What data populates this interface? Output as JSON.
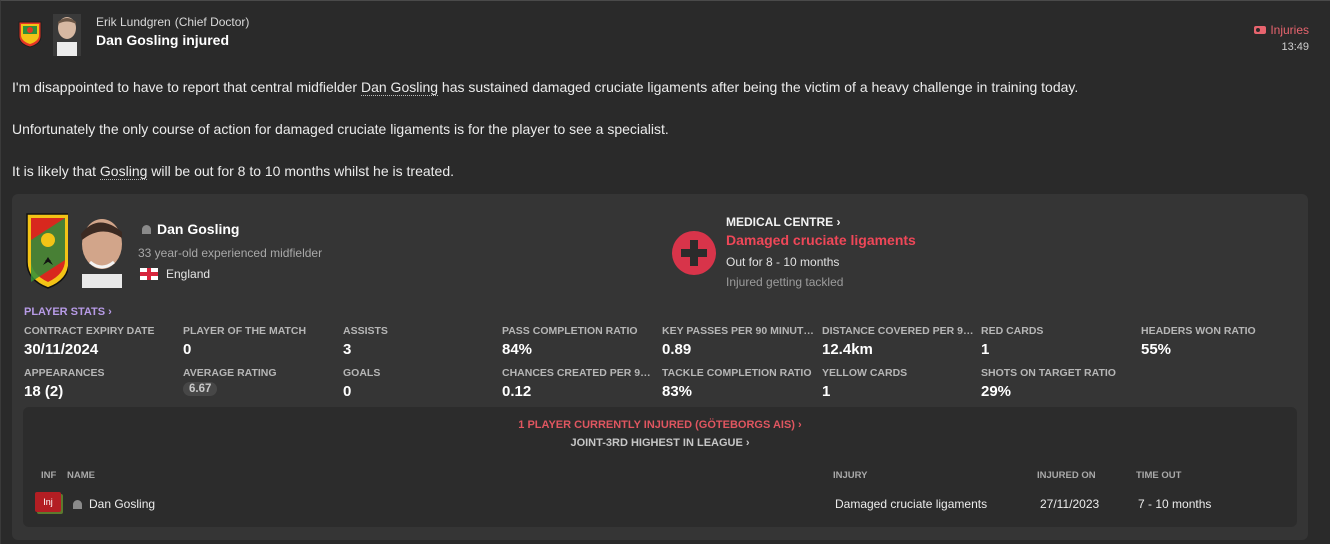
{
  "header": {
    "sender_name": "Erik Lundgren",
    "sender_role": "(Chief Doctor)",
    "subject": "Dan Gosling injured",
    "tag": "Injuries",
    "time": "13:49"
  },
  "message": {
    "p1_pre": "I'm disappointed to have to report that central midfielder ",
    "p1_link": "Dan Gosling",
    "p1_post": " has sustained damaged cruciate ligaments after being the victim of a heavy challenge in training today.",
    "p2": "Unfortunately the only course of action for damaged cruciate ligaments is for the player to see a specialist.",
    "p3_pre": "It is likely that ",
    "p3_link": "Gosling",
    "p3_post": " will be out for 8 to 10 months whilst he is treated."
  },
  "player": {
    "name": "Dan Gosling",
    "description": "33 year-old experienced midfielder",
    "nation": "England"
  },
  "medical": {
    "title": "MEDICAL CENTRE",
    "injury": "Damaged cruciate ligaments",
    "out_for": "Out for 8 - 10 months",
    "cause": "Injured getting tackled"
  },
  "stats": {
    "title": "PLAYER STATS",
    "items": [
      {
        "label": "CONTRACT EXPIRY DATE",
        "value": "30/11/2024"
      },
      {
        "label": "PLAYER OF THE MATCH",
        "value": "0"
      },
      {
        "label": "ASSISTS",
        "value": "3"
      },
      {
        "label": "PASS COMPLETION RATIO",
        "value": "84%"
      },
      {
        "label": "KEY PASSES PER 90 MINUTES",
        "value": "0.89"
      },
      {
        "label": "DISTANCE COVERED PER 90...",
        "value": "12.4km"
      },
      {
        "label": "RED CARDS",
        "value": "1"
      },
      {
        "label": "HEADERS WON RATIO",
        "value": "55%"
      },
      {
        "label": "APPEARANCES",
        "value": "18 (2)"
      },
      {
        "label": "AVERAGE RATING",
        "value": "6.67"
      },
      {
        "label": "GOALS",
        "value": "0"
      },
      {
        "label": "CHANCES CREATED PER 90...",
        "value": "0.12"
      },
      {
        "label": "TACKLE COMPLETION RATIO",
        "value": "83%"
      },
      {
        "label": "YELLOW CARDS",
        "value": "1"
      },
      {
        "label": "SHOTS ON TARGET RATIO",
        "value": "29%"
      }
    ]
  },
  "injury_list": {
    "headline": "1 PLAYER CURRENTLY INJURED (GÖTEBORGS AIS)",
    "subline": "JOINT-3RD HIGHEST IN LEAGUE",
    "columns": {
      "inf": "INF",
      "name": "NAME",
      "injury": "INJURY",
      "injured_on": "INJURED ON",
      "time_out": "TIME OUT"
    },
    "rows": [
      {
        "inf": "Inj",
        "name": "Dan Gosling",
        "injury": "Damaged cruciate ligaments",
        "injured_on": "27/11/2023",
        "time_out": "7 - 10 months"
      }
    ]
  },
  "colors": {
    "background": "#2a2a2a",
    "card": "#353535",
    "injury_red": "#ef4758",
    "stats_purple": "#b79be6"
  },
  "icons": [
    "club-badge-icon",
    "sender-face-icon",
    "injuries-tag-icon",
    "person-icon",
    "england-flag-icon",
    "medical-cross-icon",
    "chevron-right-icon",
    "injury-status-icon"
  ]
}
